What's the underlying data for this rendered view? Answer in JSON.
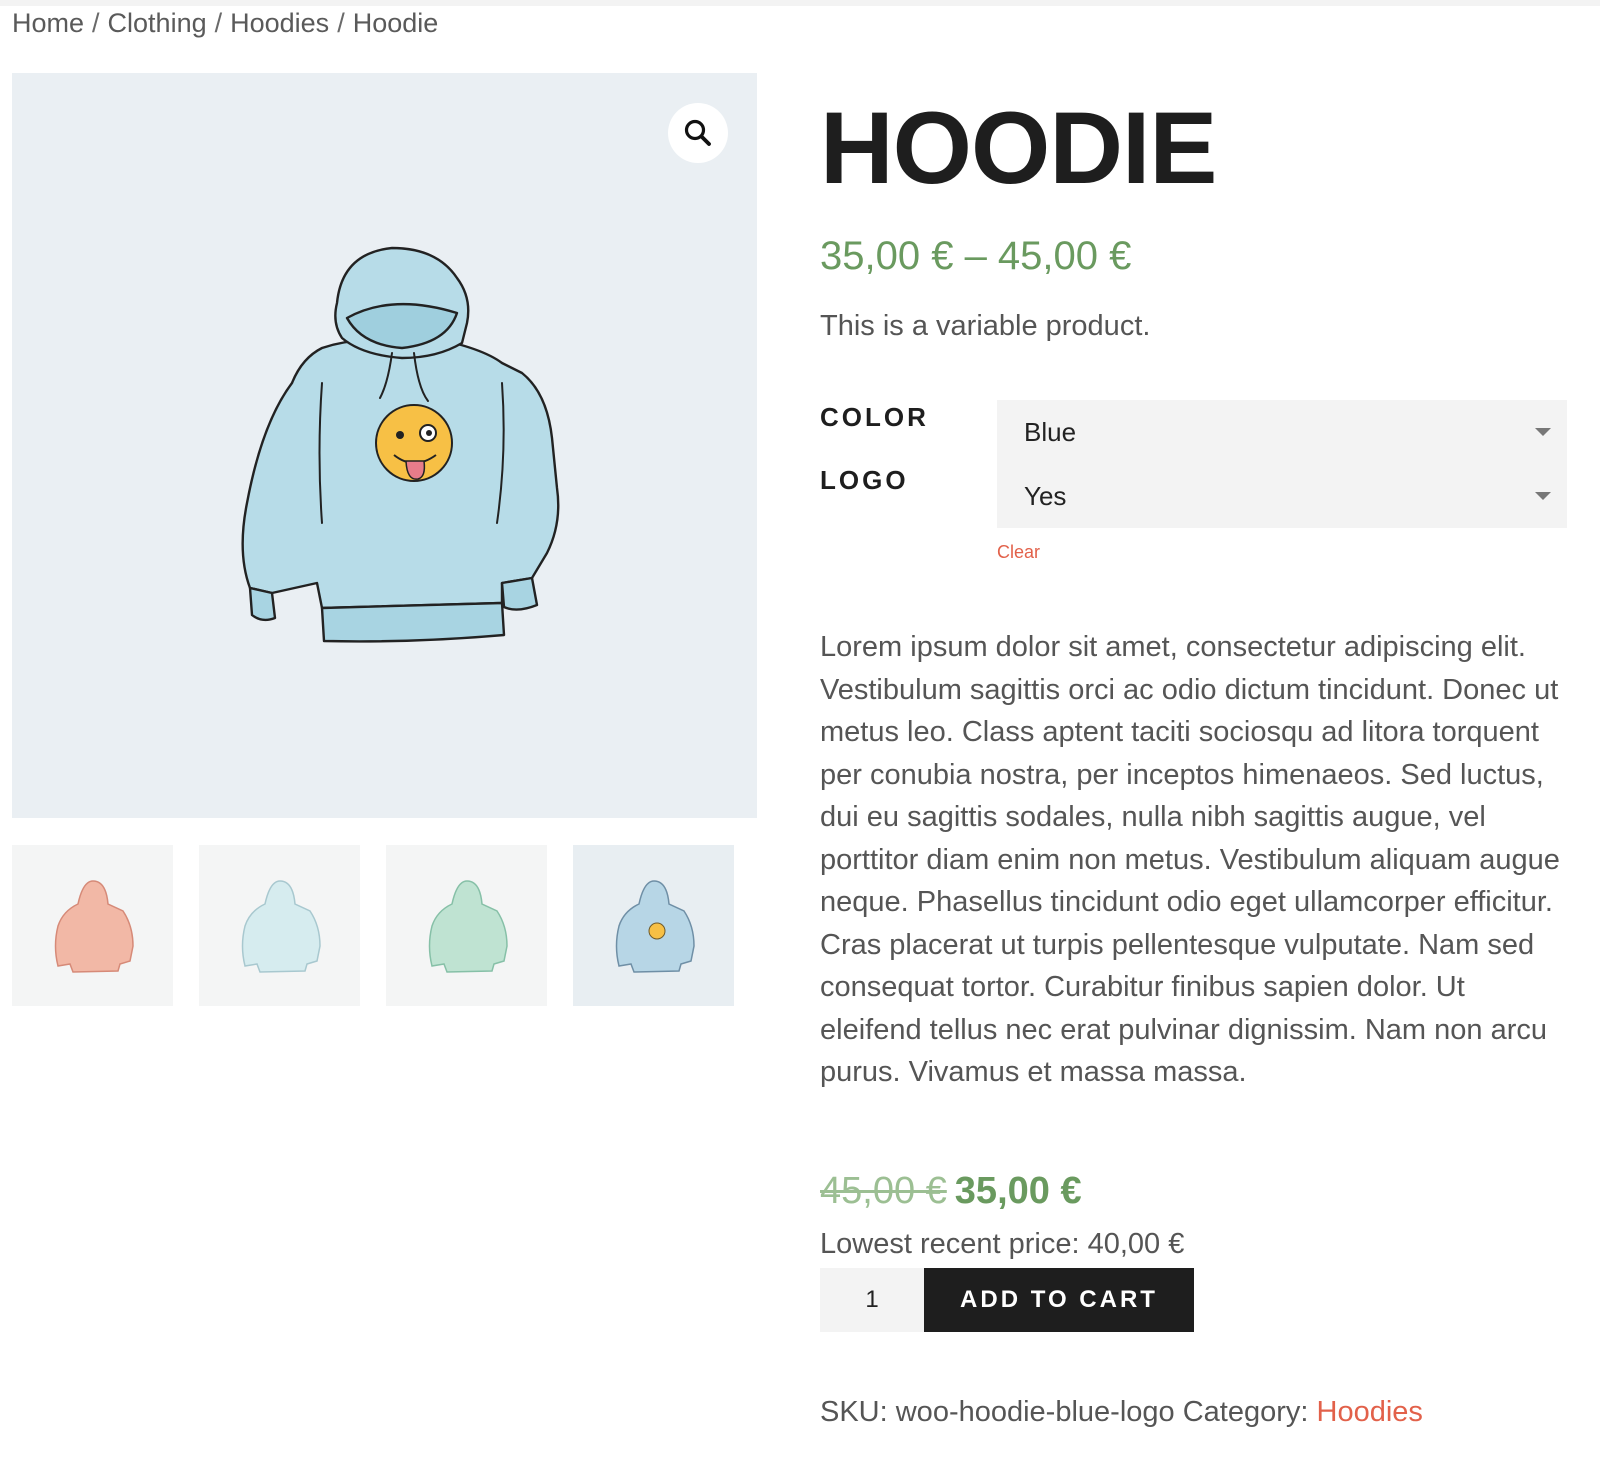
{
  "breadcrumb": {
    "items": [
      "Home",
      "Clothing",
      "Hoodies",
      "Hoodie"
    ],
    "separator": "/"
  },
  "gallery": {
    "zoom_icon": "magnifier-icon",
    "thumbnails": [
      {
        "color": "#f2b8a6",
        "label": "pink hoodie"
      },
      {
        "color": "#cfe6ea",
        "label": "light blue hoodie"
      },
      {
        "color": "#a9d8c3",
        "label": "green hoodie"
      },
      {
        "color": "#a7c9dc",
        "label": "blue hoodie with logo",
        "active": true
      }
    ]
  },
  "product": {
    "title": "HOODIE",
    "price_range": "35,00 € – 45,00 €",
    "short_description": "This is a variable product.",
    "variations": {
      "color_label": "COLOR",
      "color_value": "Blue",
      "logo_label": "LOGO",
      "logo_value": "Yes",
      "clear_label": "Clear"
    },
    "description": "Lorem ipsum dolor sit amet, consectetur adipiscing elit. Vestibulum sagittis orci ac odio dictum tincidunt. Donec ut metus leo. Class aptent taciti sociosqu ad litora torquent per conubia nostra, per inceptos himenaeos. Sed luctus, dui eu sagittis sodales, nulla nibh sagittis augue, vel porttitor diam enim non metus. Vestibulum aliquam augue neque. Phasellus tincidunt odio eget ullamcorper efficitur. Cras placerat ut turpis pellentesque vulputate. Nam sed consequat tortor. Curabitur finibus sapien dolor. Ut eleifend tellus nec erat pulvinar dignissim. Nam non arcu purus. Vivamus et massa massa.",
    "old_price": "45,00 €",
    "sale_price": "35,00 €",
    "lowest_price": "Lowest recent price: 40,00 €",
    "quantity": "1",
    "add_to_cart_label": "ADD TO CART",
    "sku_text": "SKU: woo-hoodie-blue-logo Category: ",
    "category_link": "Hoodies"
  },
  "colors": {
    "price_green": "#6a9a5f",
    "link_orange": "#e2614a",
    "button_dark": "#1e1e1e",
    "gallery_bg": "#eaeff3"
  }
}
